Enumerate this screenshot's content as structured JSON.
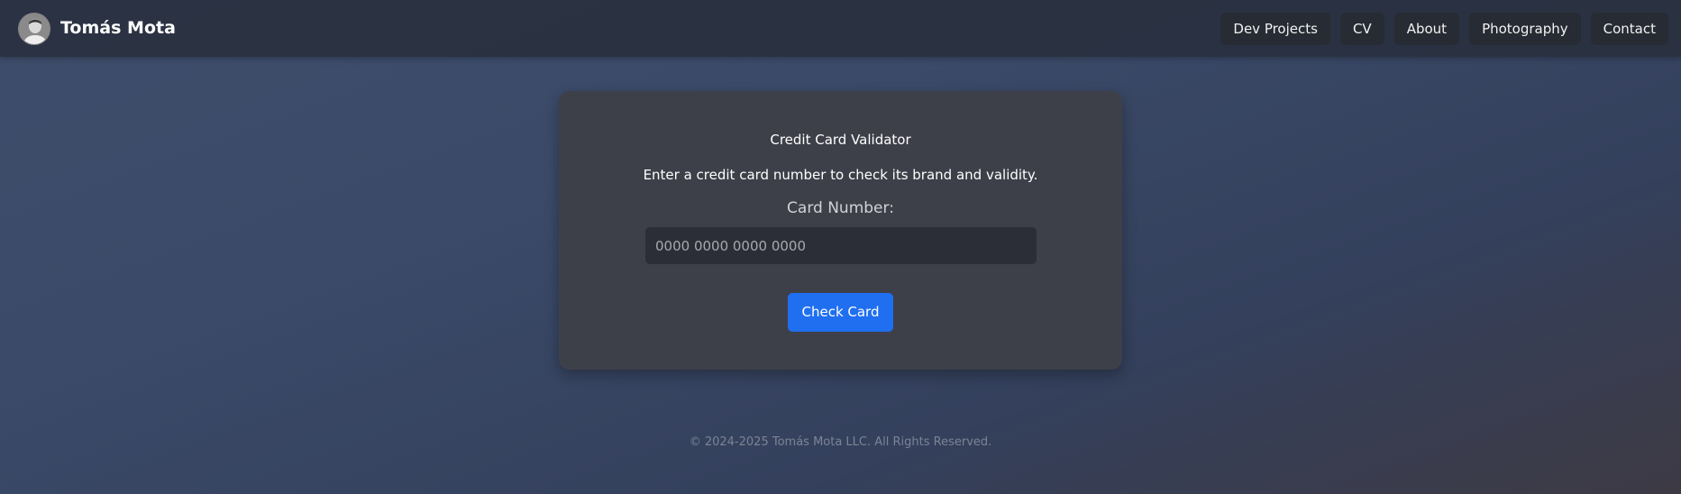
{
  "header": {
    "brand_name": "Tomás Mota",
    "nav": [
      {
        "label": "Dev Projects"
      },
      {
        "label": "CV"
      },
      {
        "label": "About"
      },
      {
        "label": "Photography"
      },
      {
        "label": "Contact"
      }
    ]
  },
  "validator": {
    "title": "Credit Card Validator",
    "description": "Enter a credit card number to check its brand and validity.",
    "field_label": "Card Number:",
    "input_placeholder": "0000 0000 0000 0000",
    "input_value": "",
    "button_label": "Check Card"
  },
  "footer": {
    "copyright": "© 2024-2025 Tomás Mota LLC. All Rights Reserved."
  },
  "colors": {
    "primary_button": "#1f6ff0",
    "nav_button_bg": "#272b33",
    "card_bg": "#3e4049"
  }
}
